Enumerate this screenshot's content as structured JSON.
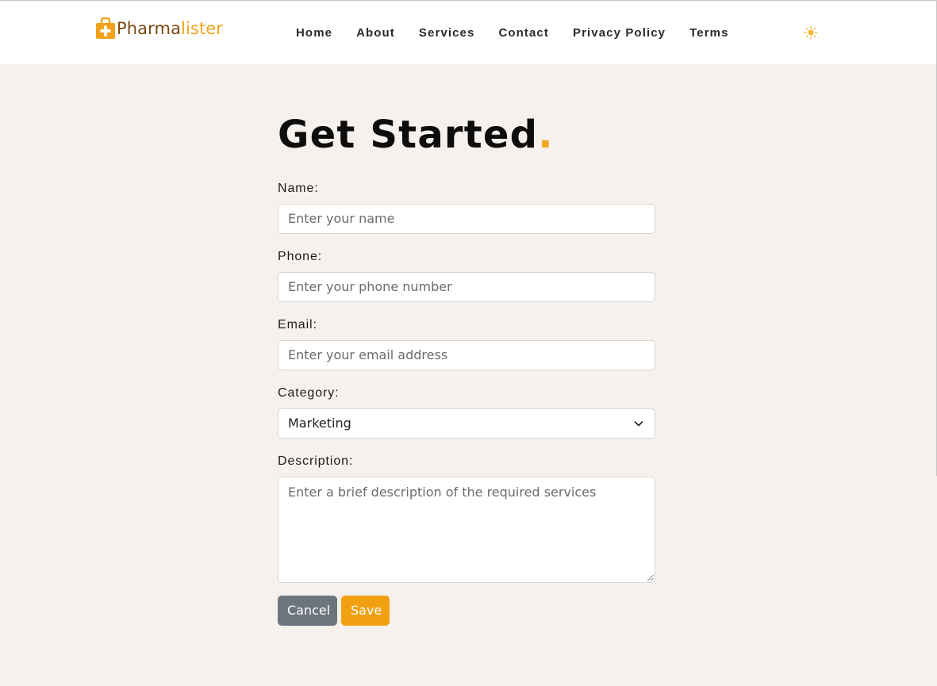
{
  "brand": {
    "name_part1": "Pharma",
    "name_part2": "lister",
    "accent_color": "#f0a31a",
    "dark_color": "#7a4a12"
  },
  "nav": {
    "items": [
      "Home",
      "About",
      "Services",
      "Contact",
      "Privacy Policy",
      "Terms"
    ]
  },
  "theme_toggle": {
    "icon": "sun-icon",
    "symbol": "☀"
  },
  "page": {
    "title": "Get Started",
    "title_dot": "."
  },
  "form": {
    "name": {
      "label": "Name:",
      "placeholder": "Enter your name"
    },
    "phone": {
      "label": "Phone:",
      "placeholder": "Enter your phone number"
    },
    "email": {
      "label": "Email:",
      "placeholder": "Enter your email address"
    },
    "category": {
      "label": "Category:",
      "value": "Marketing"
    },
    "description": {
      "label": "Description:",
      "placeholder": "Enter a brief description of the required services"
    },
    "cancel_label": "Cancel",
    "save_label": "Save"
  },
  "colors": {
    "background": "#f6f1ec",
    "cancel_button": "#6c757d",
    "save_button": "#f0a010"
  }
}
